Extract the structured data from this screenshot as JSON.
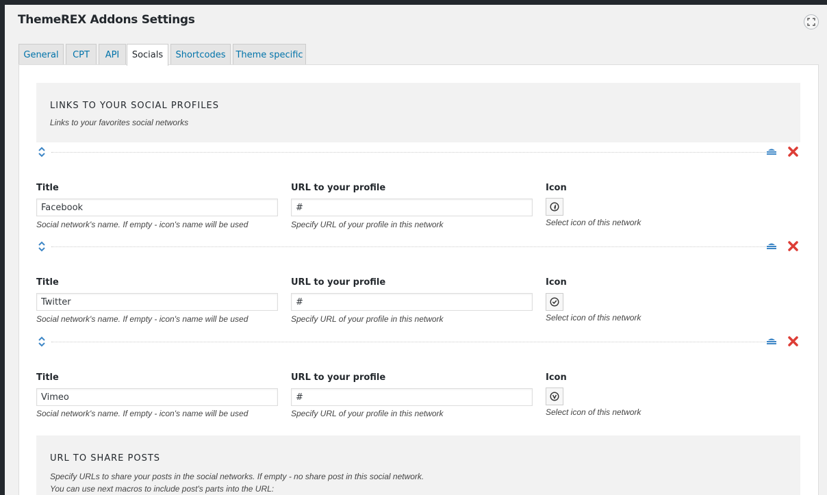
{
  "page": {
    "title": "ThemeREX Addons Settings"
  },
  "tabs": [
    {
      "label": "General"
    },
    {
      "label": "CPT"
    },
    {
      "label": "API"
    },
    {
      "label": "Socials"
    },
    {
      "label": "Shortcodes"
    },
    {
      "label": "Theme specific"
    }
  ],
  "sections": {
    "socials": {
      "title": "LINKS TO YOUR SOCIAL PROFILES",
      "description": "Links to your favorites social networks"
    },
    "share": {
      "title": "URL TO SHARE POSTS",
      "description_line1": "Specify URLs to share your posts in the social networks. If empty - no share post in this social network.",
      "description_line2": "You can use next macros to include post's parts into the URL:"
    }
  },
  "labels": {
    "title": "Title",
    "url": "URL to your profile",
    "icon": "Icon",
    "title_hint": "Social network's name. If empty - icon's name will be used",
    "url_hint": "Specify URL of your profile in this network",
    "icon_hint": "Select icon of this network"
  },
  "rows": [
    {
      "title": "Facebook",
      "url": "#",
      "icon": "facebook-icon"
    },
    {
      "title": "Twitter",
      "url": "#",
      "icon": "twitter-icon"
    },
    {
      "title": "Vimeo",
      "url": "#",
      "icon": "vimeo-icon"
    }
  ],
  "colors": {
    "accent": "#0073aa",
    "delete": "#dd3d36",
    "clone": "#3d86c6"
  }
}
